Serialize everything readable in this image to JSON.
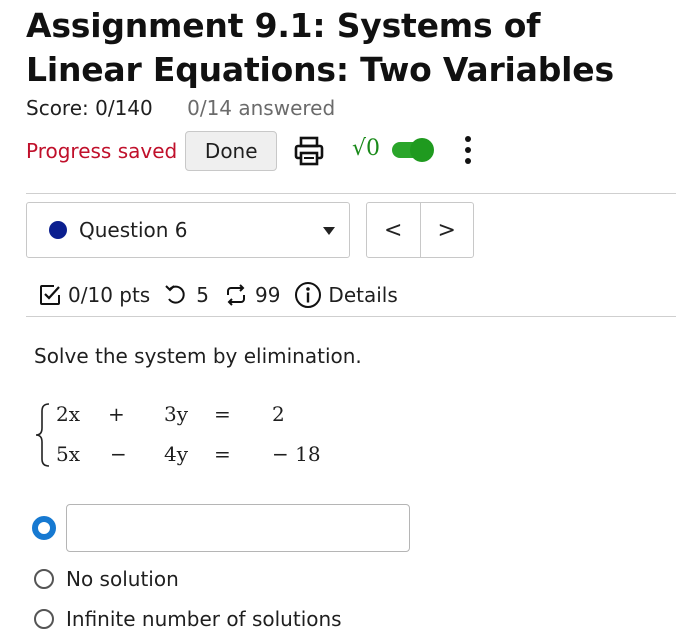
{
  "header": {
    "title": "Assignment 9.1: Systems of Linear Equations: Two Variables",
    "score": "Score: 0/140",
    "answered": "0/14 answered"
  },
  "toolbar": {
    "progress_saved": "Progress saved",
    "done_label": "Done",
    "print_icon": "printer-icon",
    "math_toggle_label": "√0",
    "math_toggle_on": true,
    "math_toggle_color": "#1f9a1f",
    "more_icon": "kebab-menu-icon"
  },
  "question_nav": {
    "selected": "Question 6",
    "status_dot_color": "#0b1f8f",
    "prev_label": "<",
    "next_label": ">"
  },
  "question_meta": {
    "points": "0/10 pts",
    "retries": "5",
    "versions": "99",
    "details": "Details"
  },
  "question": {
    "prompt": "Solve the system by elimination.",
    "equations": [
      {
        "a": "2x",
        "op": "+",
        "b": "3y",
        "eq": "=",
        "c": "2"
      },
      {
        "a": "5x",
        "op": "−",
        "b": "4y",
        "eq": "=",
        "c": "− 18"
      }
    ]
  },
  "answer_options": [
    {
      "label": "",
      "type": "input",
      "selected": true,
      "value": ""
    },
    {
      "label": "No solution",
      "selected": false
    },
    {
      "label": "Infinite number of solutions",
      "selected": false
    }
  ],
  "colors": {
    "accent_red": "#c0102b",
    "radio_selected": "#1679d1"
  }
}
